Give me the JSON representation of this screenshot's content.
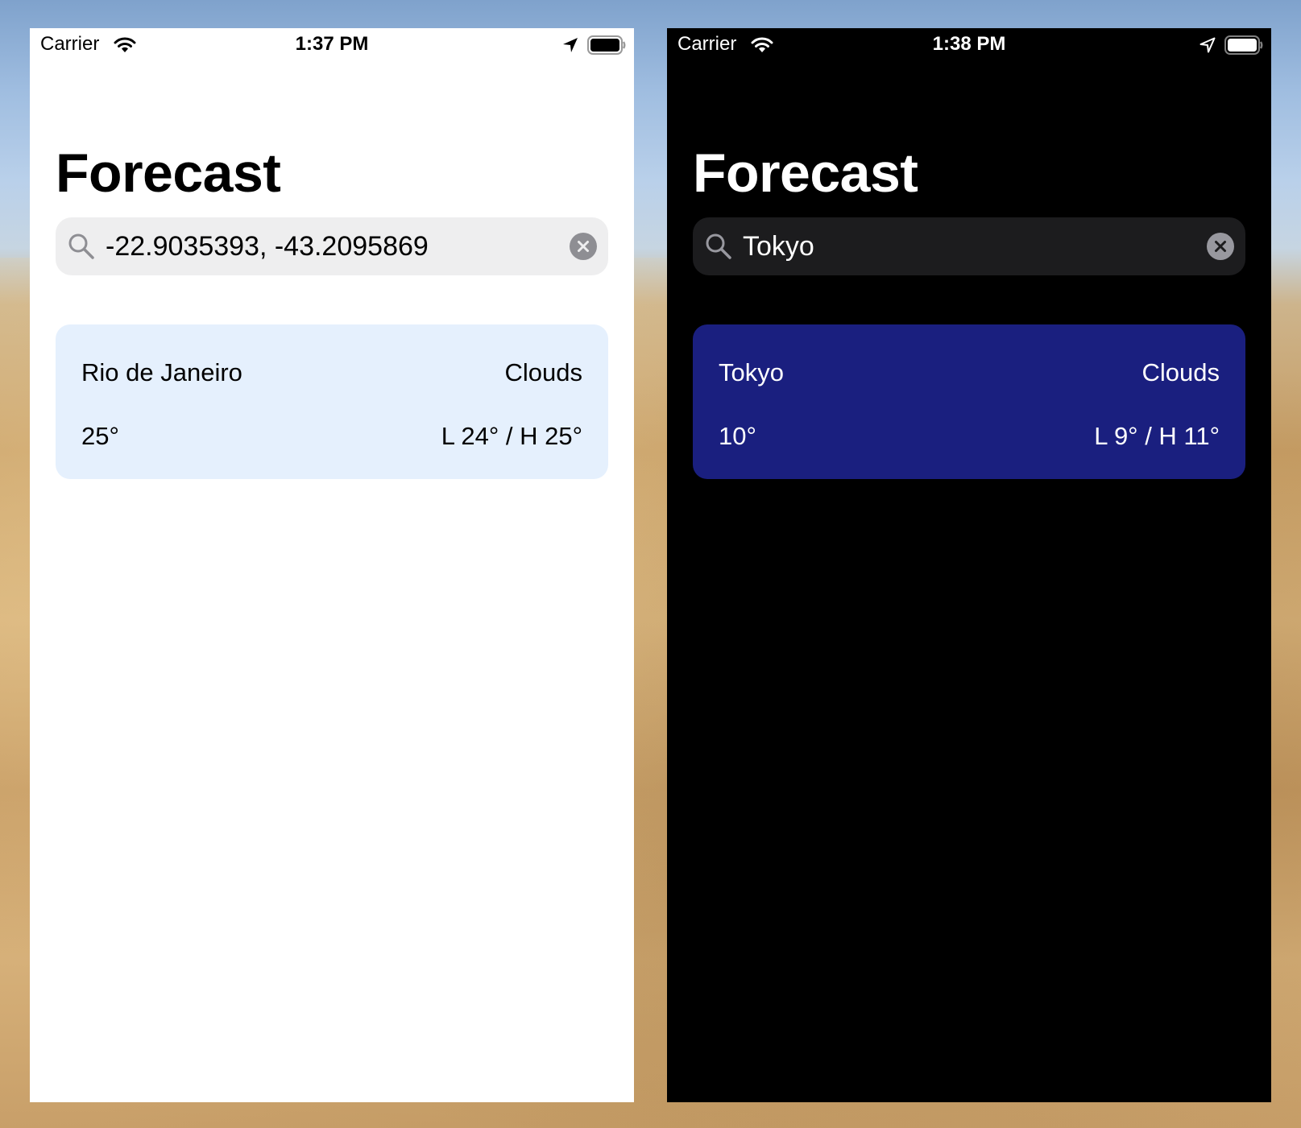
{
  "screens": [
    {
      "theme": "light",
      "status_bar": {
        "carrier": "Carrier",
        "time": "1:37 PM",
        "location_icon": "location-arrow-filled-icon",
        "wifi_icon": "wifi-icon",
        "battery_icon": "battery-icon"
      },
      "title": "Forecast",
      "search": {
        "value": "-22.9035393, -43.2095869",
        "search_icon": "search-icon",
        "clear_icon": "clear-circle-icon"
      },
      "card": {
        "city": "Rio de Janeiro",
        "condition": "Clouds",
        "temperature": "25°",
        "low_high": "L 24° / H 25°"
      },
      "colors": {
        "background": "#ffffff",
        "text": "#000000",
        "search_background": "#eeeeef",
        "card_background": "#e5f0fd"
      }
    },
    {
      "theme": "dark",
      "status_bar": {
        "carrier": "Carrier",
        "time": "1:38 PM",
        "location_icon": "location-arrow-outline-icon",
        "wifi_icon": "wifi-icon",
        "battery_icon": "battery-icon"
      },
      "title": "Forecast",
      "search": {
        "value": "Tokyo",
        "search_icon": "search-icon",
        "clear_icon": "clear-circle-icon"
      },
      "card": {
        "city": "Tokyo",
        "condition": "Clouds",
        "temperature": "10°",
        "low_high": "L 9° / H 11°"
      },
      "colors": {
        "background": "#000000",
        "text": "#ffffff",
        "search_background": "#1c1c1e",
        "card_background": "#1a1f7f"
      }
    }
  ]
}
